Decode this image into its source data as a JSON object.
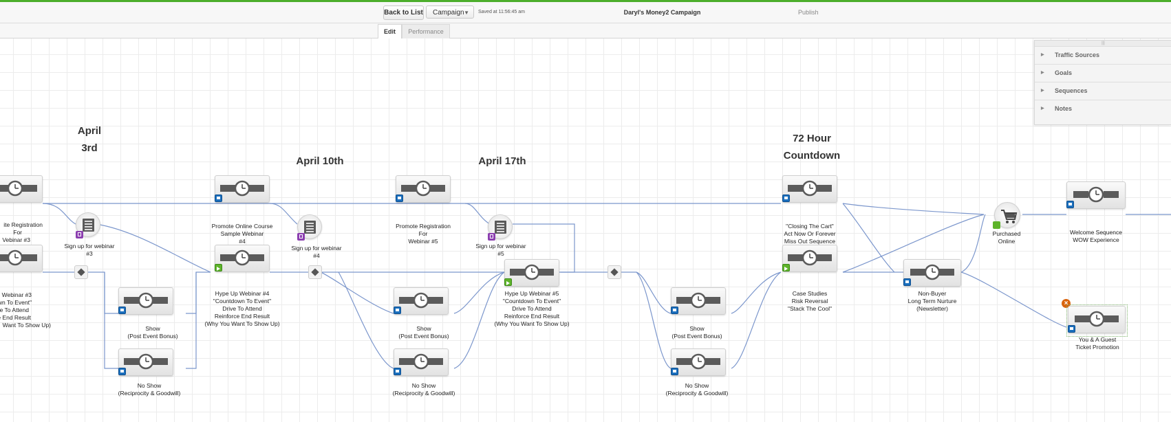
{
  "toolbar": {
    "back_label": "Back to List",
    "campaign_label": "Campaign",
    "saved_text": "Saved at 11:56:45 am",
    "campaign_title": "Daryl's Money2 Campaign",
    "publish_label": "Publish"
  },
  "tabs": {
    "edit": "Edit",
    "performance": "Performance"
  },
  "panel": {
    "items": [
      "Traffic Sources",
      "Goals",
      "Sequences",
      "Notes"
    ]
  },
  "headings": {
    "april3_line1": "April",
    "april3_line2": "3rd",
    "april10": "April 10th",
    "april17": "April 17th",
    "countdown_line1": "72 Hour",
    "countdown_line2": "Countdown"
  },
  "nodes": {
    "reg_webinar3": [
      "ite Registration",
      "For",
      "Vebinar #3"
    ],
    "signup3": [
      "Sign up for webinar",
      "#3"
    ],
    "hype3": [
      "Up Webinar #3",
      "down To Event\"",
      "ve To Attend",
      "rce End Result",
      "Want To Show Up)"
    ],
    "show_a": [
      "Show",
      "(Post Event Bonus)"
    ],
    "noshow_a": [
      "No Show",
      "(Reciprocity & Goodwill)"
    ],
    "promote_course": [
      "Promote Online Course",
      "Sample Webinar",
      "#4"
    ],
    "hype4": [
      "Hype Up Webinar #4",
      "\"Countdown To Event\"",
      "Drive To Attend",
      "Reinforce End Result",
      "(Why You Want To Show Up)"
    ],
    "signup4": [
      "Sign up for webinar",
      "#4"
    ],
    "promote_reg5": [
      "Promote Registration",
      "For",
      "Webinar #5"
    ],
    "show_b": [
      "Show",
      "(Post Event Bonus)"
    ],
    "noshow_b": [
      "No Show",
      "(Reciprocity & Goodwill)"
    ],
    "signup5": [
      "Sign up for webinar",
      "#5"
    ],
    "hype5": [
      "Hype Up Webinar #5",
      "\"Countdown To Event\"",
      "Drive To Attend",
      "Reinforce End Result",
      "(Why You Want To Show Up)"
    ],
    "show_c": [
      "Show",
      "(Post Event Bonus)"
    ],
    "noshow_c": [
      "No Show",
      "(Reciprocity & Goodwill)"
    ],
    "closing_cart": [
      "\"Closing The Cart\"",
      "Act Now Or Forever",
      "Miss Out Sequence"
    ],
    "case_studies": [
      "Case Studies",
      "Risk Reversal",
      "\"Stack The Cool\""
    ],
    "non_buyer": [
      "Non-Buyer",
      "Long Term Nurture",
      "(Newsletter)"
    ],
    "purchased": [
      "Purchased",
      "Online"
    ],
    "welcome": [
      "Welcome Sequence",
      "WOW Experience"
    ],
    "guest_ticket": [
      "You & A Guest",
      "Ticket Promotion"
    ]
  },
  "colors": {
    "accent_green": "#4cae2c",
    "flag_blue": "#1b6fbd",
    "goal_green": "#5eb32a",
    "form_purple": "#8c3fb0",
    "wire_blue": "#6f8fc9",
    "cancel_orange": "#d9640d"
  }
}
